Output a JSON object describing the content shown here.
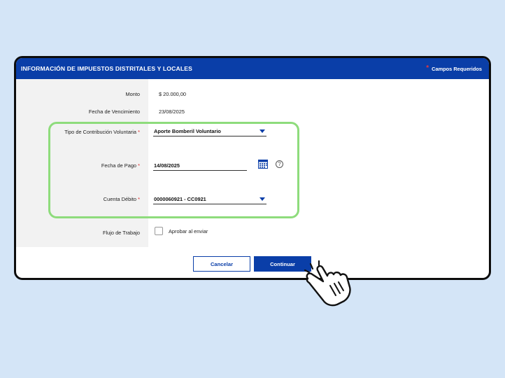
{
  "header": {
    "title": "INFORMACIÓN DE IMPUESTOS DISTRITALES Y LOCALES",
    "required_label": "Campos Requeridos"
  },
  "fields": {
    "monto": {
      "label": "Monto",
      "value": "$ 20.000,00"
    },
    "vencimiento": {
      "label": "Fecha de Vencimiento",
      "value": "23/08/2025"
    },
    "tipo": {
      "label": "Tipo de Contribución Voluntaria",
      "value": "Aporte Bomberil Voluntario"
    },
    "fecha_pago": {
      "label": "Fecha de Pago",
      "value": "14/08/2025"
    },
    "cuenta": {
      "label": "Cuenta Débito",
      "value": "0000060921 - CC0921"
    },
    "flujo": {
      "label": "Flujo de Trabajo",
      "checkbox_label": "Aprobar al enviar"
    }
  },
  "buttons": {
    "cancel": "Cancelar",
    "continue": "Continuar"
  },
  "colors": {
    "primary": "#0a3ea8",
    "highlight": "#8edc7c",
    "required": "#e2383f"
  }
}
